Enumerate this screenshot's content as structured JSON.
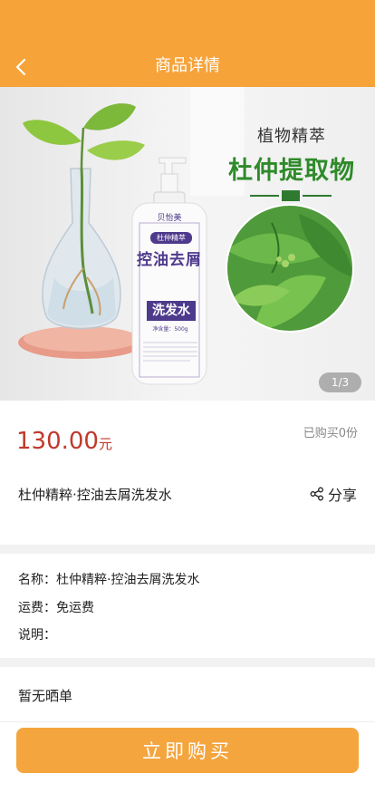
{
  "header": {
    "title": "商品详情"
  },
  "hero": {
    "headline": "植物精萃",
    "subheadline": "杜仲提取物",
    "counter": "1/3",
    "bottle": {
      "brand": "贝怡美",
      "tag": "杜仲精萃",
      "line1": "控油去屑",
      "line2": "洗发水",
      "net_weight": "净含量：500g"
    }
  },
  "product": {
    "price": "130.00",
    "price_unit": "元",
    "sold": "已购买0份",
    "name": "杜仲精粹·控油去屑洗发水",
    "share_label": "分享"
  },
  "details": {
    "name_label": "名称：",
    "name_value": "杜仲精粹·控油去屑洗发水",
    "shipping_label": "运费：",
    "shipping_value": "免运费",
    "desc_label": "说明："
  },
  "reviews": {
    "empty_text": "暂无晒单"
  },
  "actions": {
    "buy_label": "立即购买"
  },
  "colors": {
    "header": "#f6a33a",
    "buy_button": "#f4a53e",
    "price": "#c0392b",
    "green": "#2f8a2a"
  }
}
